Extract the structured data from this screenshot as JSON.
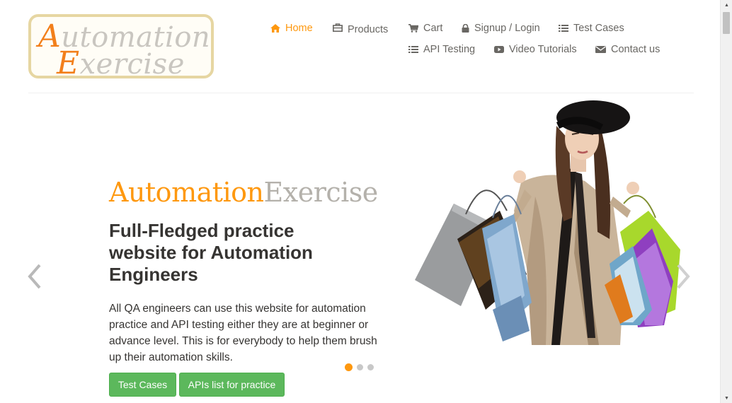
{
  "logo": {
    "line1_first": "A",
    "line1_rest": "utomation",
    "line2_first": "E",
    "line2_rest": "xercise"
  },
  "nav": {
    "home": "Home",
    "products": "Products",
    "cart": "Cart",
    "signup_login": "Signup / Login",
    "test_cases": "Test Cases",
    "api_testing": "API Testing",
    "video_tutorials": "Video Tutorials",
    "contact_us": "Contact us"
  },
  "icons": {
    "home": "home-icon",
    "products": "briefcase-icon",
    "cart": "shopping-cart-icon",
    "signup_login": "lock-icon",
    "test_cases": "list-icon",
    "api_testing": "list-icon",
    "video_tutorials": "youtube-play-icon",
    "contact_us": "envelope-icon"
  },
  "slider": {
    "brand_a": "Automation",
    "brand_b": "Exercise",
    "headline": "Full-Fledged practice website for Automation Engineers",
    "description": "All QA engineers can use this website for automation practice and API testing either they are at beginner or advance level. This is for everybody to help them brush up their automation skills.",
    "button_test_cases": "Test Cases",
    "button_apis": "APIs list for practice",
    "total_slides": 3,
    "active_slide": 1
  },
  "colors": {
    "accent": "#fe980f",
    "text": "#696763",
    "heading": "#363432",
    "button_green": "#5cb85c",
    "brand_grey": "#b4b1ab"
  }
}
